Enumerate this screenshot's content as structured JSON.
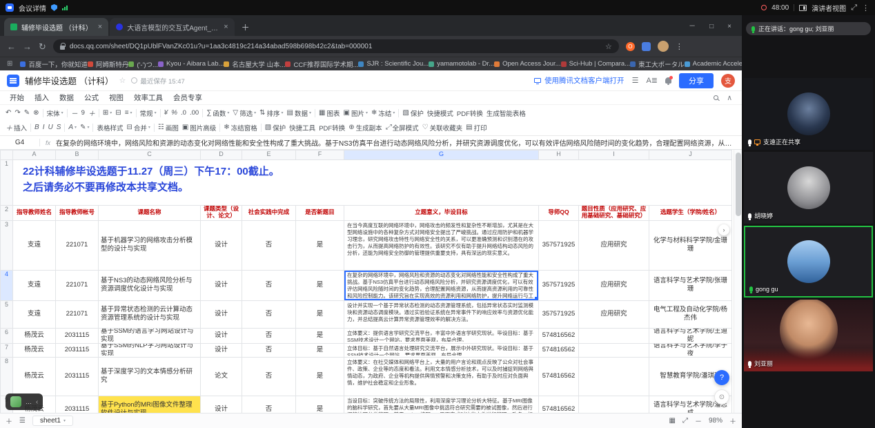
{
  "meeting": {
    "topbar": {
      "detail_label": "会议详情",
      "timer": "48:00",
      "view_label": "演讲者视图"
    },
    "speaking_label": "正在讲话：gong gu; 刘亚丽",
    "participants": [
      {
        "name": "支遠正在共享",
        "sharing": true
      },
      {
        "name": "胡晓婷"
      },
      {
        "name": "gong gu",
        "active": true
      },
      {
        "name": "刘亚丽"
      }
    ]
  },
  "browser": {
    "tabs": [
      {
        "title": "辅修毕设选题 （计科）",
        "active": true
      },
      {
        "title": "大语言模型的交互式Agent_百..."
      }
    ],
    "url": "docs.qq.com/sheet/DQ1pUblFVanZKc01u?u=1aa3c4819c214a34abad598b698b42c2&tab=000001",
    "bookmarks": [
      {
        "label": "百度一下，你就知道",
        "color": "#3b6fe0"
      },
      {
        "label": "阿姆斯特丹",
        "color": "#d0493a"
      },
      {
        "label": "('-')つ...",
        "color": "#6aa84f"
      },
      {
        "label": "Kyou - Aibara Lab...",
        "color": "#8a63c9"
      },
      {
        "label": "名古屋大学 山本...",
        "color": "#d8a13a"
      },
      {
        "label": "CCF推荐国际学术期...",
        "color": "#c23f3f"
      },
      {
        "label": "SJR : Scientific Jou...",
        "color": "#3f86c2"
      },
      {
        "label": "yamamotolab - Dr...",
        "color": "#46a68a"
      },
      {
        "label": "Open Access Jour...",
        "color": "#e07b39"
      },
      {
        "label": "Sci-Hub | Compara...",
        "color": "#b03a3a"
      },
      {
        "label": "東工大ポータル",
        "color": "#3a66b0"
      },
      {
        "label": "Academic Acceler...",
        "color": "#4a9bd6"
      }
    ]
  },
  "docs": {
    "header": {
      "title": "辅修毕设选题 （计科）",
      "saved": "最近保存 15:47",
      "open_client": "使用腾讯文档客户端打开",
      "share_label": "分享",
      "avatar_initial": "支"
    },
    "menus": [
      "开始",
      "插入",
      "数据",
      "公式",
      "视图",
      "效率工具",
      "会员专享"
    ],
    "toolbar": {
      "row1": [
        {
          "i": "↶"
        },
        {
          "i": "↷"
        },
        {
          "i": "✎"
        },
        {
          "i": "⊗"
        },
        {
          "sep": 1
        },
        {
          "t": "宋体",
          "c": 1
        },
        {
          "sep": 1
        },
        {
          "i": "－"
        },
        {
          "t": "9"
        },
        {
          "i": "＋"
        },
        {
          "sep": 1
        },
        {
          "i": "⊞",
          "c": 1
        },
        {
          "i": "⊟"
        },
        {
          "i": "≡",
          "c": 1
        },
        {
          "sep": 1
        },
        {
          "t": "常规",
          "c": 1
        },
        {
          "sep": 1
        },
        {
          "i": "¥"
        },
        {
          "i": "%"
        },
        {
          "t": ".0"
        },
        {
          "t": ".00"
        },
        {
          "sep": 1
        },
        {
          "i": "∑",
          "t": "函数",
          "c": 1
        },
        {
          "i": "▽",
          "t": "筛选",
          "c": 1
        },
        {
          "i": "⇅",
          "t": "排序",
          "c": 1
        },
        {
          "i": "▤",
          "t": "数据",
          "c": 1
        },
        {
          "sep": 1
        },
        {
          "i": "▦",
          "t": "图表"
        },
        {
          "i": "▣",
          "t": "图片",
          "c": 1
        },
        {
          "i": "❄",
          "t": "冻结",
          "c": 1
        },
        {
          "sep": 1
        },
        {
          "i": "▧",
          "t": "保护"
        },
        {
          "t": "快捷模式"
        },
        {
          "t": "PDF转换"
        },
        {
          "t": "生成智能表格"
        }
      ],
      "row2": [
        {
          "i": "＋",
          "t": "插入"
        },
        {
          "sep": 1
        },
        {
          "i": "B"
        },
        {
          "i": "I"
        },
        {
          "i": "U"
        },
        {
          "i": "S"
        },
        {
          "sep": 1
        },
        {
          "i": "A",
          "c": 1
        },
        {
          "i": "✎",
          "c": 1
        },
        {
          "sep": 1
        },
        {
          "t": "表格样式"
        },
        {
          "i": "⊟",
          "t": "合并",
          "c": 1
        },
        {
          "sep": 1
        },
        {
          "i": "☷",
          "t": "画图"
        },
        {
          "i": "▣",
          "t": "图片高级"
        },
        {
          "sep": 1
        },
        {
          "i": "❄",
          "t": "冻结窗格"
        },
        {
          "sep": 1
        },
        {
          "i": "▧",
          "t": "保护"
        },
        {
          "t": "快捷工具"
        },
        {
          "t": "PDF转换"
        },
        {
          "i": "⊕",
          "t": "生成副本"
        },
        {
          "i": "⤢",
          "t": "全屏模式"
        },
        {
          "i": "♡",
          "t": "关联收藏夹"
        },
        {
          "i": "▤",
          "t": "打印"
        }
      ]
    },
    "formula": {
      "cell_ref": "G4",
      "fx": "fx",
      "value": "在复杂的网络环境中，网络风险和资源的动态变化对网络性能和安全性构成了重大挑战。基于NS3仿真平台进行动态网络风险分析，并研究资源调度优化，可以有效评估网络风险随时间的变化趋势，合理配置网络资源，从而提高资源利用的可靠性和风险控制能力。该研究旨在实现高效的资源利用和网络防护，提升网络运行与工程能力。"
    },
    "statusbar": {
      "sheet_tab": "sheet1",
      "zoom": "98%"
    }
  },
  "sheet": {
    "columns": [
      "A",
      "B",
      "C",
      "D",
      "E",
      "F",
      "G",
      "H",
      "I",
      "J"
    ],
    "title_lines": [
      "22计科辅修毕设选题于11.27（周三）下午17：00截止。",
      "之后请务必不要再修改本共享文档。"
    ],
    "headers": [
      "指导教师姓名",
      "指导教师帐号",
      "课题名称",
      "课题类型（设计、论文）",
      "社会实践中完成",
      "是否新题目",
      "立题意义，毕设目标",
      "导师QQ",
      "题目性质（应用研究、应用基础研究、基础研究）",
      "选题学生（学院/姓名）"
    ],
    "rows": [
      [
        "支遠",
        "221071",
        "基于机器学习的网络攻击分析模型的设计与实现",
        "设计",
        "否",
        "是",
        "在当今高度互联的网络环境中，网络攻击的频发性和复杂性不断增加，尤其是在大型网络设施中的各种复杂方式对网络安全提出了严峻挑战。通过应用防护和机器学习理念，研究网络攻击特性与网络安全性的关系，可以更准确预测和识别潜在的攻击行为，从而提高网络防护的有效性。该研究不仅有助于提升网络结构动态风险的分析，还能为网络安全防御的管理提供重要支持，具有深远的现实意义。",
        "357571925",
        "应用研究",
        "化学与材料科学学院/金珊珊"
      ],
      [
        "支遠",
        "221071",
        "基于NS3的动态网络风险分析与资源调度优化设计与实现",
        "设计",
        "否",
        "是",
        "在复杂的网络环境中，网络风险和资源的动态变化对网络性能和安全性构成了重大挑战。基于NS3仿真平台进行动态网络风险分析，并研究资源调度优化，可以有效评估网络风险随时间的变化趋势，合理配置网络资源，从而提高资源利用的可靠性和风险控制能力。该研究旨在实现高效的资源利用和网络防护，提升网络运行与工程能力。",
        "357571925",
        "应用研究",
        "语言科学与艺术学院/张珊珊"
      ],
      [
        "支遠",
        "221071",
        "基于异常状态检测的云计算动态资源管理系统的设计与实现",
        "设计",
        "否",
        "是",
        "设计并实现一个基于异常状态检测的动态资源管理系统，包括异常状态实时监测模块和资源动态调度模块。通过实验验证系统在异常事件下的响应效率与资源优化能力，并总结提高云计算异常资源管理效率的解决方法。",
        "357571925",
        "应用研究",
        "电气工程及自动化学院/杨杰伟"
      ],
      [
        "杨茂云",
        "2031115",
        "基于SSM的语言学习网站设计与实现",
        "设计",
        "否",
        "是",
        "立体要义：提供语言学研究交流平台，丰富中外语言学研究现状。毕设目标：基于SSM技术设计一个网站，要求界面美观，布局合理。",
        "574816562",
        "",
        "语言科学与艺术学院/王迪妮"
      ],
      [
        "杨茂云",
        "2031115",
        "基于SSM的NLP学习网站设计与实现",
        "设计",
        "否",
        "是",
        "立体目标：基于自然语言处理研究交流平台，展示中外研究现状。毕设目标：基于SSM技术设计一个网站，要求界面美观，布局合理。",
        "574816562",
        "",
        "语言科学与艺术学院/李子夜"
      ],
      [
        "杨茂云",
        "2031115",
        "基于深度学习的文本情感分析研究",
        "论文",
        "否",
        "是",
        "立体要义：在社交媒体和网络平台上，大量的用户言论和观点反映了公众对社会事件、政策、企业等的态度和看法。利用文本情感分析技术，可以及时捕捉到网络舆情动态，为政府、企业等机构提供舆情预警和决策支持，有助于及时应对负面舆情，维护社会稳定和企业形象。",
        "574816562",
        "",
        "智慧教育学院/潘琪琪"
      ],
      [
        "杨茂云",
        "2031115",
        "基于Python的MRI图像文件整理软件设计与实现",
        "设计",
        "否",
        "是",
        "当设目标：突破传统方法的局限性，利用深度学习理论分析大特征。基于MRI图像的脑科学研究，首先要从大量MRI图像中挑选符合研究需要的被试图像，然后进行调整处理分类整理。基于Python编写GUI界面完成对这些文件进行整理、改名、标准化等操作。",
        "574816562",
        "",
        "语言科学与艺术学院/潘志成"
      ]
    ]
  },
  "overlay": {
    "text": "…"
  }
}
